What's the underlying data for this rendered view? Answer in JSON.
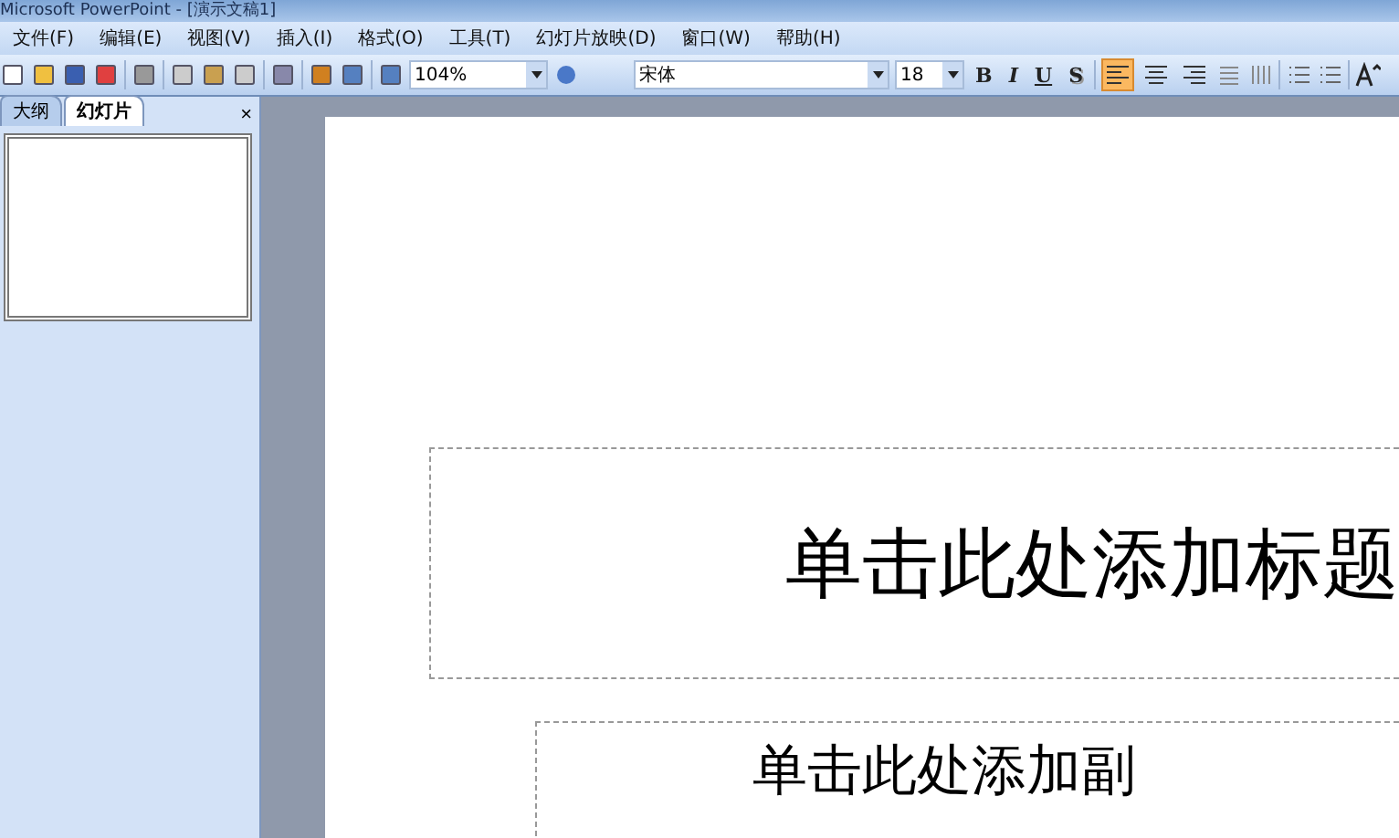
{
  "window": {
    "title": "Microsoft PowerPoint - [演示文稿1]"
  },
  "menu": [
    "文件(F)",
    "编辑(E)",
    "视图(V)",
    "插入(I)",
    "格式(O)",
    "工具(T)",
    "幻灯片放映(D)",
    "窗口(W)",
    "帮助(H)"
  ],
  "toolbar": {
    "zoom": "104%",
    "font": "宋体",
    "size": "18",
    "format_buttons": [
      {
        "label": "B",
        "kind": "bold"
      },
      {
        "label": "I",
        "kind": "italic"
      },
      {
        "label": "U",
        "kind": "underline"
      },
      {
        "label": "S",
        "kind": "shadow"
      }
    ],
    "align_buttons": [
      {
        "kind": "left",
        "selected": true
      },
      {
        "kind": "center",
        "selected": false
      },
      {
        "kind": "right",
        "selected": false
      }
    ]
  },
  "panel": {
    "tabs": [
      {
        "label": "大纲",
        "selected": false
      },
      {
        "label": "幻灯片",
        "selected": true
      }
    ],
    "close": "×"
  },
  "slide": {
    "title_placeholder": "单击此处添加标题",
    "subtitle_placeholder": "单击此处添加副"
  }
}
